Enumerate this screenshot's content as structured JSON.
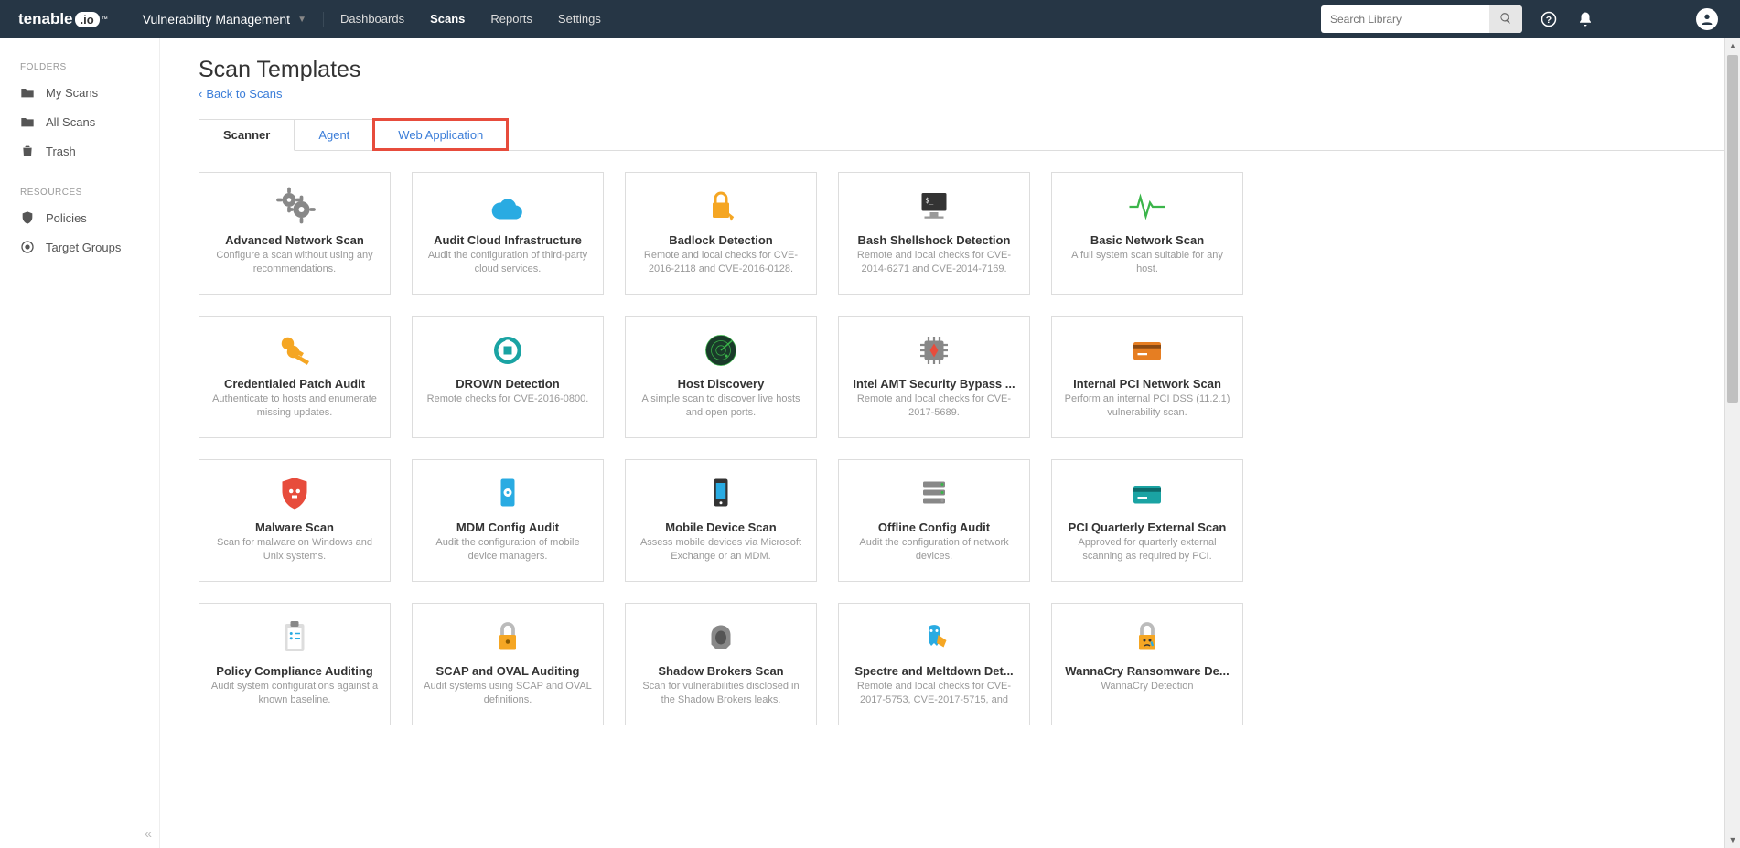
{
  "brand": {
    "name": "tenable",
    "suffix": ".io",
    "tm": "™"
  },
  "app_switcher": "Vulnerability Management",
  "nav": [
    "Dashboards",
    "Scans",
    "Reports",
    "Settings"
  ],
  "nav_active": 1,
  "search": {
    "placeholder": "Search Library"
  },
  "sidebar": {
    "folders_header": "FOLDERS",
    "folders": [
      "My Scans",
      "All Scans",
      "Trash"
    ],
    "resources_header": "RESOURCES",
    "resources": [
      "Policies",
      "Target Groups"
    ]
  },
  "page": {
    "title": "Scan Templates",
    "back": "Back to Scans"
  },
  "tabs": [
    "Scanner",
    "Agent",
    "Web Application"
  ],
  "templates": [
    {
      "title": "Advanced Network Scan",
      "desc": "Configure a scan without using any recommendations.",
      "icon": "gears"
    },
    {
      "title": "Audit Cloud Infrastructure",
      "desc": "Audit the configuration of third-party cloud services.",
      "icon": "cloud"
    },
    {
      "title": "Badlock Detection",
      "desc": "Remote and local checks for CVE-2016-2118 and CVE-2016-0128.",
      "icon": "badlock"
    },
    {
      "title": "Bash Shellshock Detection",
      "desc": "Remote and local checks for CVE-2014-6271 and CVE-2014-7169.",
      "icon": "terminal"
    },
    {
      "title": "Basic Network Scan",
      "desc": "A full system scan suitable for any host.",
      "icon": "pulse"
    },
    {
      "title": "Credentialed Patch Audit",
      "desc": "Authenticate to hosts and enumerate missing updates.",
      "icon": "keys"
    },
    {
      "title": "DROWN Detection",
      "desc": "Remote checks for CVE-2016-0800.",
      "icon": "drown"
    },
    {
      "title": "Host Discovery",
      "desc": "A simple scan to discover live hosts and open ports.",
      "icon": "radar"
    },
    {
      "title": "Intel AMT Security Bypass ...",
      "desc": "Remote and local checks for CVE-2017-5689.",
      "icon": "cpu"
    },
    {
      "title": "Internal PCI Network Scan",
      "desc": "Perform an internal PCI DSS (11.2.1) vulnerability scan.",
      "icon": "card-orange"
    },
    {
      "title": "Malware Scan",
      "desc": "Scan for malware on Windows and Unix systems.",
      "icon": "shield-skull"
    },
    {
      "title": "MDM Config Audit",
      "desc": "Audit the configuration of mobile device managers.",
      "icon": "phone-gear"
    },
    {
      "title": "Mobile Device Scan",
      "desc": "Assess mobile devices via Microsoft Exchange or an MDM.",
      "icon": "phone"
    },
    {
      "title": "Offline Config Audit",
      "desc": "Audit the configuration of network devices.",
      "icon": "servers-off"
    },
    {
      "title": "PCI Quarterly External Scan",
      "desc": "Approved for quarterly external scanning as required by PCI.",
      "icon": "card-teal"
    },
    {
      "title": "Policy Compliance Auditing",
      "desc": "Audit system configurations against a known baseline.",
      "icon": "clipboard"
    },
    {
      "title": "SCAP and OVAL Auditing",
      "desc": "Audit systems using SCAP and OVAL definitions.",
      "icon": "lock-gold"
    },
    {
      "title": "Shadow Brokers Scan",
      "desc": "Scan for vulnerabilities disclosed in the Shadow Brokers leaks.",
      "icon": "shadow"
    },
    {
      "title": "Spectre and Meltdown Det...",
      "desc": "Remote and local checks for CVE-2017-5753, CVE-2017-5715, and",
      "icon": "spectre"
    },
    {
      "title": "WannaCry Ransomware De...",
      "desc": "WannaCry Detection",
      "icon": "lock-cry"
    }
  ]
}
